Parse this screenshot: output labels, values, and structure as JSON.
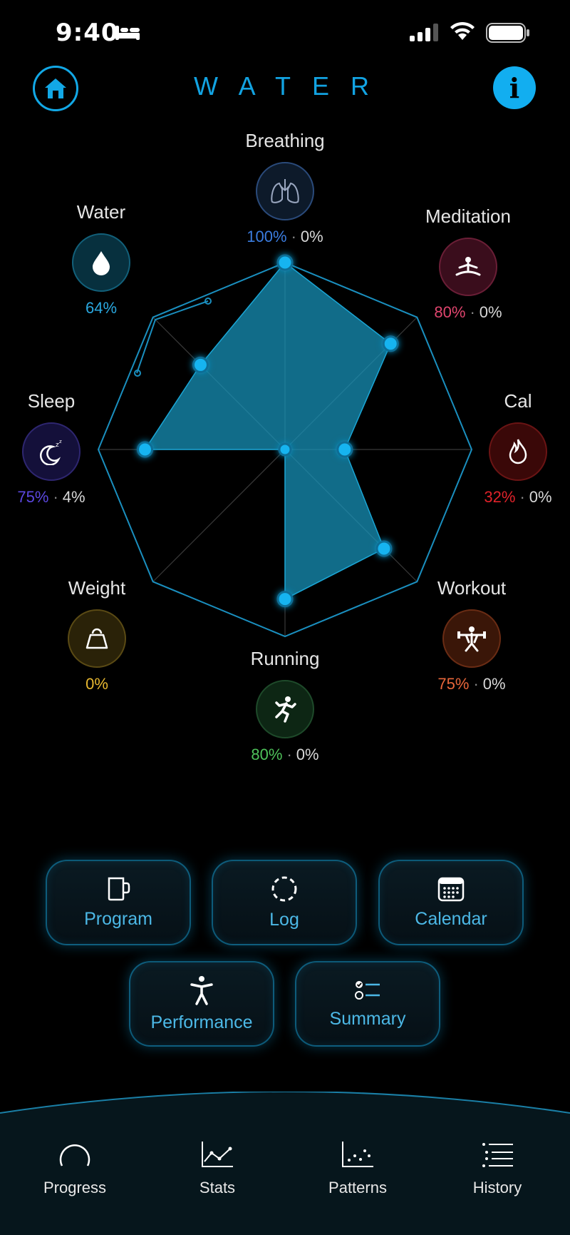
{
  "status_bar": {
    "time": "9:40"
  },
  "header": {
    "title": "WATER",
    "info_label": "i"
  },
  "metrics": {
    "breathing": {
      "label": "Breathing",
      "value": "100%",
      "secondary": "0%",
      "color": "#3b7de0"
    },
    "meditation": {
      "label": "Meditation",
      "value": "80%",
      "secondary": "0%",
      "color": "#e0456e"
    },
    "cal": {
      "label": "Cal",
      "value": "32%",
      "secondary": "0%",
      "color": "#e0222a"
    },
    "workout": {
      "label": "Workout",
      "value": "75%",
      "secondary": "0%",
      "color": "#e8663a"
    },
    "running": {
      "label": "Running",
      "value": "80%",
      "secondary": "0%",
      "color": "#4ec25a"
    },
    "weight": {
      "label": "Weight",
      "value": "0%",
      "color": "#e8b830"
    },
    "sleep": {
      "label": "Sleep",
      "value": "75%",
      "secondary": "4%",
      "color": "#5b47e0"
    },
    "water": {
      "label": "Water",
      "value": "64%",
      "color": "#2aa8e0"
    }
  },
  "separator": "·",
  "chart_data": {
    "type": "radar",
    "axes": [
      "Breathing",
      "Meditation",
      "Cal",
      "Workout",
      "Running",
      "Weight",
      "Sleep",
      "Water"
    ],
    "values": [
      100,
      80,
      32,
      75,
      80,
      0,
      75,
      64
    ],
    "secondary_values": [
      0,
      0,
      0,
      0,
      0,
      null,
      4,
      null
    ],
    "range": [
      0,
      100
    ]
  },
  "actions": {
    "program": "Program",
    "log": "Log",
    "calendar": "Calendar",
    "performance": "Performance",
    "summary": "Summary"
  },
  "tabs": {
    "progress": "Progress",
    "stats": "Stats",
    "patterns": "Patterns",
    "history": "History"
  },
  "accent_color": "#12a8e6"
}
